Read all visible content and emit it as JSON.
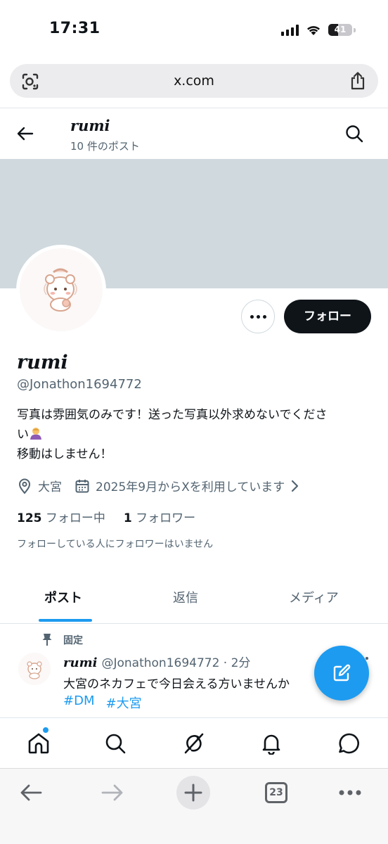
{
  "status_bar": {
    "time": "17:31",
    "battery": "41",
    "battery_level": 0.41
  },
  "browser": {
    "url": "x.com",
    "tabs_count": "23"
  },
  "header": {
    "name": "rumi",
    "post_count": "10 件のポスト"
  },
  "profile": {
    "name": "rumi",
    "handle": "@Jonathon1694772",
    "follow_label": "フォロー",
    "bio_line1": "写真は雰囲気のみです！送った写真以外求めないでくださ",
    "bio_line2": "い",
    "bio_line3": "移動はしません！",
    "location": "大宮",
    "joined": "2025年9月からXを利用しています",
    "following_count": "125",
    "following_label": "フォロー中",
    "followers_count": "1",
    "followers_label": "フォロワー",
    "no_followers_note": "フォローしている人にフォロワーはいません"
  },
  "tabs": [
    {
      "label": "ポスト",
      "active": true
    },
    {
      "label": "返信",
      "active": false
    },
    {
      "label": "メディア",
      "active": false
    }
  ],
  "pinned_post": {
    "pinned_label": "固定",
    "author": "rumi",
    "handle_time": "@Jonathon1694772 · 2分",
    "text": "大宮のネカフェで今日会える方いませんか",
    "tags": [
      "#DM",
      "#大宮"
    ]
  },
  "bottom_nav": [
    "home-icon",
    "search-icon",
    "grok-icon",
    "notifications-icon",
    "messages-icon"
  ],
  "colors": {
    "accent": "#1d9bf0",
    "banner": "#cfd9de",
    "text": "#0f1419",
    "secondary": "#536471"
  }
}
